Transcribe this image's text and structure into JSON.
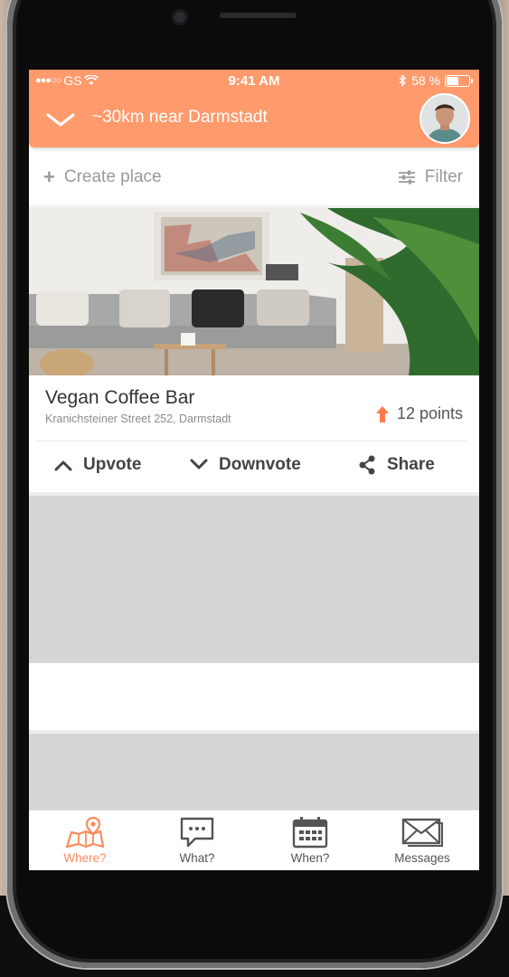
{
  "status_bar": {
    "carrier": "GS",
    "time": "9:41 AM",
    "battery": "58 %",
    "battery_level": 0.58
  },
  "header": {
    "location": "~30km near Darmstadt",
    "accent_color": "#ff9a6c"
  },
  "toolbar": {
    "create_label": "Create place",
    "filter_label": "Filter"
  },
  "place": {
    "name": "Vegan Coffee Bar",
    "address": "Kranichsteiner Street 252, Darmstadt",
    "points": "12 points"
  },
  "actions": {
    "upvote": "Upvote",
    "downvote": "Downvote",
    "share": "Share"
  },
  "tabs": [
    {
      "label": "Where?",
      "icon": "map-pin-icon",
      "active": true
    },
    {
      "label": "What?",
      "icon": "chat-bubble-icon",
      "active": false
    },
    {
      "label": "When?",
      "icon": "calendar-icon",
      "active": false
    },
    {
      "label": "Messages",
      "icon": "envelope-icon",
      "active": false
    }
  ]
}
